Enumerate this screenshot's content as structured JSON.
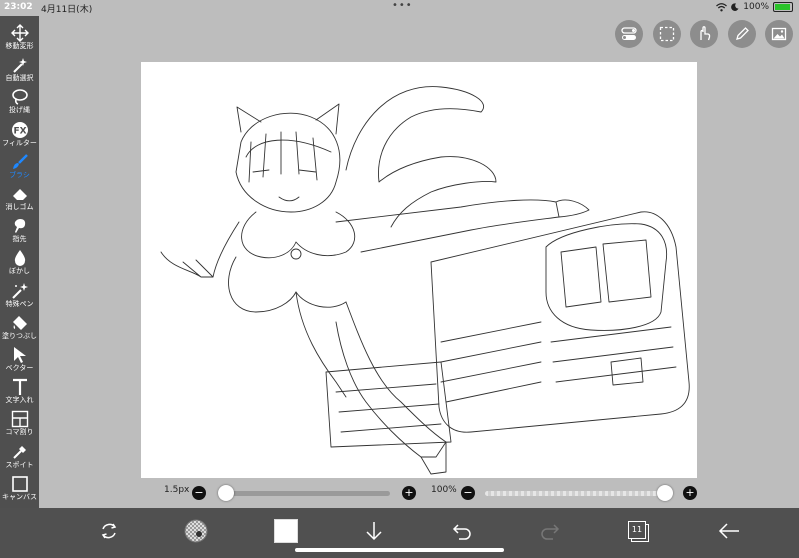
{
  "status": {
    "time": "23:02",
    "date": "4月11日(木)",
    "battery": "100%"
  },
  "tools": [
    {
      "name": "move-transform",
      "label": "移動変形",
      "icon": "move-icon"
    },
    {
      "name": "auto-select",
      "label": "自動選択",
      "icon": "magic-wand-icon"
    },
    {
      "name": "lasso",
      "label": "投げ縄",
      "icon": "lasso-icon"
    },
    {
      "name": "filter",
      "label": "フィルター",
      "icon": "fx-icon"
    },
    {
      "name": "brush",
      "label": "ブラシ",
      "icon": "brush-icon",
      "active": true
    },
    {
      "name": "eraser",
      "label": "消しゴム",
      "icon": "eraser-icon"
    },
    {
      "name": "finger",
      "label": "指先",
      "icon": "smudge-icon"
    },
    {
      "name": "blur",
      "label": "ぼかし",
      "icon": "drop-icon"
    },
    {
      "name": "special-pen",
      "label": "特殊ペン",
      "icon": "sparkle-pen-icon"
    },
    {
      "name": "fill",
      "label": "塗りつぶし",
      "icon": "bucket-icon"
    },
    {
      "name": "vector",
      "label": "ベクター",
      "icon": "cursor-icon"
    },
    {
      "name": "text",
      "label": "文字入れ",
      "icon": "text-icon"
    },
    {
      "name": "frame-divide",
      "label": "コマ割り",
      "icon": "panel-icon"
    },
    {
      "name": "eyedropper",
      "label": "スポイト",
      "icon": "eyedropper-icon"
    },
    {
      "name": "canvas",
      "label": "キャンバス",
      "icon": "canvas-icon"
    }
  ],
  "brush": {
    "size_label": "1.5px",
    "size_fraction": 0.0,
    "opacity_label": "100%",
    "opacity_fraction": 1.0,
    "size_minus": "−",
    "size_plus": "+",
    "opacity_minus": "−",
    "opacity_plus": "+"
  },
  "bottom": {
    "layers_count": "11"
  },
  "colors": {
    "toolbar_bg": "#4f4f4f",
    "active_tool": "#1e88ff",
    "workspace_bg": "#bdbdbd"
  }
}
